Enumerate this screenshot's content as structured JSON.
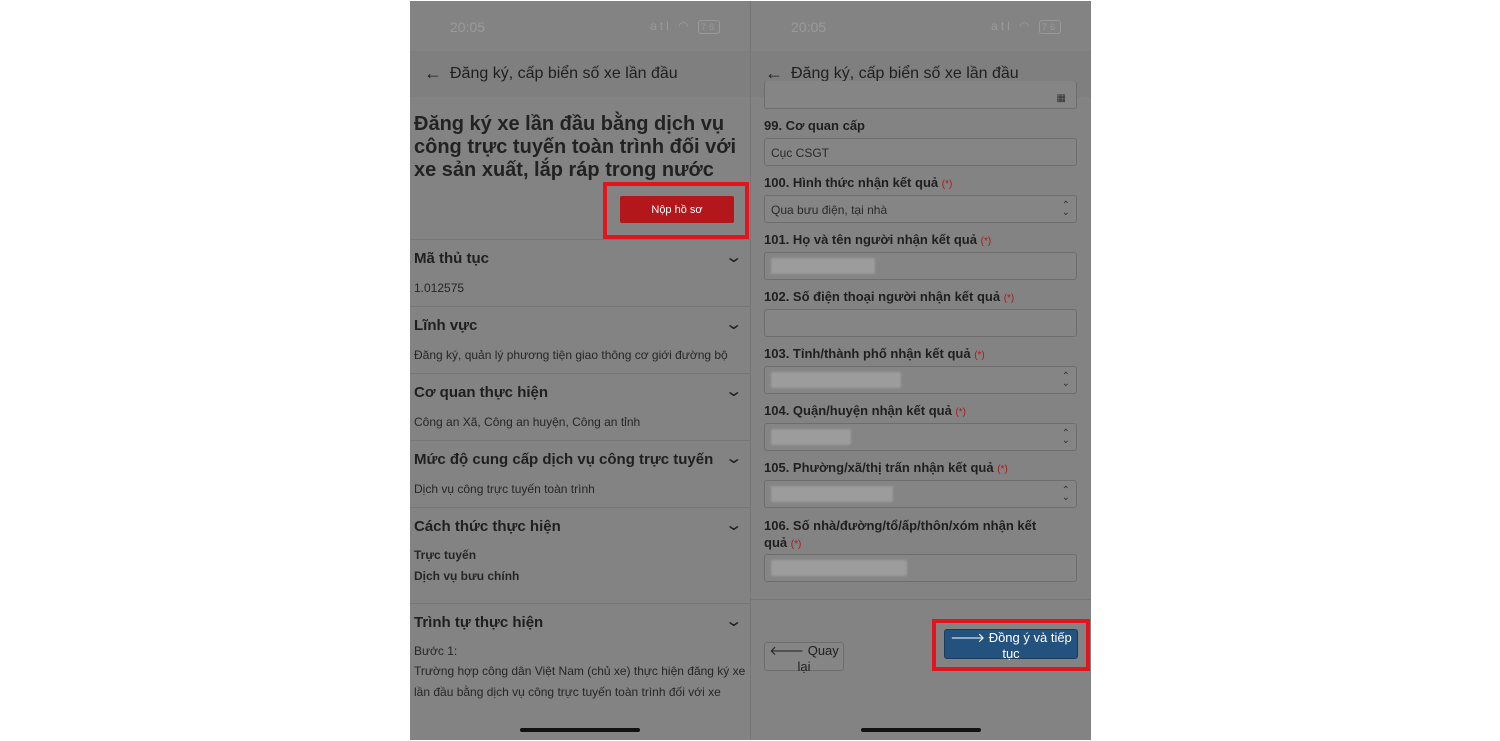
{
  "left_screen": {
    "status": {
      "time": "20:05",
      "signal": "atl",
      "battery": "76"
    },
    "header": {
      "title": "Đăng ký, cấp biển số xe lần đầu"
    },
    "procedure_title": "Đăng ký xe lần đầu bằng dịch vụ công trực tuyến toàn trình đối với xe sản xuất, lắp ráp trong nước",
    "submit_label": "Nộp hồ sơ",
    "sections": [
      {
        "title": "Mã thủ tục",
        "value": "1.012575"
      },
      {
        "title": "Lĩnh vực",
        "value": "Đăng ký, quản lý phương tiện giao thông cơ giới đường bộ"
      },
      {
        "title": "Cơ quan thực hiện",
        "value": "Công an Xã, Công an huyện, Công an tỉnh"
      },
      {
        "title": "Mức độ cung cấp dịch vụ công trực tuyến",
        "value": "Dịch vụ công trực tuyến toàn trình"
      },
      {
        "title": "Cách thức thực hiện",
        "values": [
          "Trực tuyến",
          "Dịch vụ bưu chính"
        ]
      },
      {
        "title": "Trình tự thực hiện",
        "step": "Bước 1:",
        "text": "Trường hợp công dân Việt Nam (chủ xe) thực hiện đăng ký xe lần đầu bằng dịch vụ công trực tuyến toàn trình đối với xe"
      }
    ]
  },
  "right_screen": {
    "status": {
      "time": "20:05",
      "signal": "atl",
      "battery": "76"
    },
    "header": {
      "title": "Đăng ký, cấp biển số xe lần đầu"
    },
    "required_mark": "(*)",
    "fields": [
      {
        "label": "99. Cơ quan cấp",
        "value": "Cục CSGT"
      },
      {
        "label": "100. Hình thức nhận kết quả",
        "value": "Qua bưu điện, tại nhà"
      },
      {
        "label": "101. Họ và tên người nhận kết quả",
        "value": ""
      },
      {
        "label": "102. Số điện thoại người nhận kết quả",
        "value": ""
      },
      {
        "label": "103. Tỉnh/thành phố nhận kết quả",
        "value": ""
      },
      {
        "label": "104. Quận/huyện nhận kết quả",
        "value": ""
      },
      {
        "label": "105. Phường/xã/thị trấn nhận kết quả",
        "value": ""
      },
      {
        "label": "106. Số nhà/đường/tổ/ấp/thôn/xóm nhận kết quả",
        "value": ""
      }
    ],
    "back_label": "Quay lại",
    "next_label": "Đồng ý và tiếp tục",
    "colors": {
      "primary": "#24527e",
      "danger": "#b3161b",
      "highlight": "#e3141c"
    }
  }
}
